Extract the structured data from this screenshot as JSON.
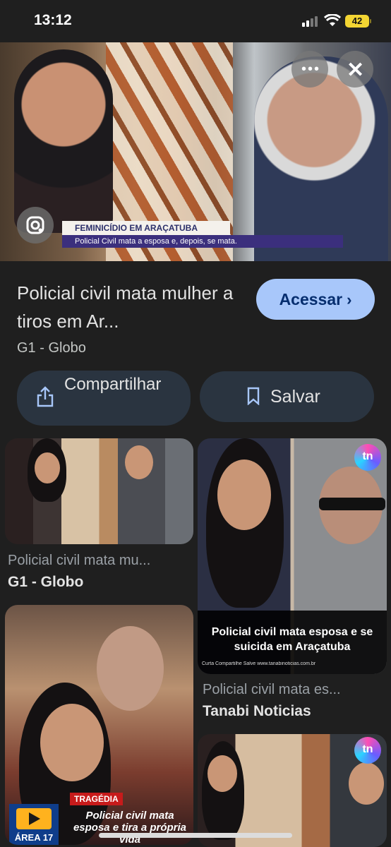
{
  "status": {
    "time": "13:12",
    "battery": "42"
  },
  "hero": {
    "headline_top": "FEMINICÍDIO EM ARAÇATUBA",
    "headline_bottom": "Policial Civil mata a esposa e, depois, se mata.",
    "more_icon": "more-horizontal-icon",
    "close_icon": "close-icon",
    "lens_icon": "google-lens-icon"
  },
  "result": {
    "title": "Policial civil mata mulher a tiros em Ar...",
    "source": "G1 - Globo",
    "visit_label": "Acessar",
    "share_label": "Compartilhar",
    "save_label": "Salvar"
  },
  "related": [
    {
      "title": "Policial civil mata mu...",
      "source": "G1 - Globo"
    },
    {
      "title": "Policial civil mata es...",
      "source": "Tanabi Noticias",
      "overlay": "Policial civil mata esposa e se suicida em Araçatuba",
      "footer": "Curta  Compartilhe  Salve  www.tanabinoticias.com.br",
      "badge": "tn"
    },
    {
      "title": "",
      "source": "",
      "badge": "ÁREA 17",
      "tag": "TRAGÉDIA",
      "overlay": "Policial civil mata esposa e tira a própria vida"
    },
    {
      "title": "",
      "source": "",
      "badge": "tn"
    }
  ],
  "colors": {
    "background": "#1f1f1f",
    "accent": "#a8c7fa",
    "pill": "#2a3440"
  }
}
